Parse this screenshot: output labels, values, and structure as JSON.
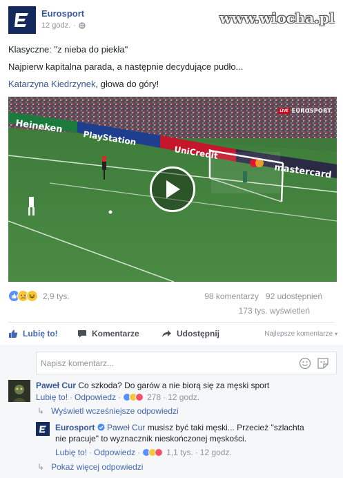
{
  "watermark": "www.wiocha.pl",
  "post": {
    "page_name": "Eurosport",
    "time": "12 godz.",
    "privacy_icon": "globe-icon",
    "lines": [
      "Klasyczne: \"z nieba do piekła\"",
      "Najpierw kapitalna parada, a następnie decydujące pudło..."
    ],
    "mention": "Katarzyna Kiedrzynek",
    "mention_suffix": ", głowa do góry!"
  },
  "video": {
    "live_tag": "LIVE",
    "channel_logo": "EUROSPORT",
    "ads": [
      "Heineken",
      "PlayStation",
      "UniCredit",
      "mastercard"
    ]
  },
  "stats": {
    "reactions_count": "2,9 tys.",
    "reaction_icons": [
      "like-icon",
      "sad-icon",
      "haha-icon"
    ],
    "comments": "98 komentarzy",
    "shares": "92 udostępnień",
    "views": "173 tys. wyświetleń"
  },
  "actions": {
    "like": "Lubię to!",
    "comment": "Komentarze",
    "share": "Udostępnij",
    "sort": "Najlepsze komentarze"
  },
  "comment_input": {
    "placeholder": "Napisz komentarz..."
  },
  "comments": [
    {
      "author": "Paweł Cur",
      "text": "Co szkoda? Do garów a nie biorą się za męski sport",
      "like": "Lubię to!",
      "reply": "Odpowiedz",
      "reactions": "278",
      "time": "12 godz."
    }
  ],
  "view_earlier_replies": "Wyświetl wcześniejsze odpowiedzi",
  "reply": {
    "author": "Eurosport",
    "mention": "Paweł Cur",
    "text_line1": "musisz być taki męski... Przecież \"szlachta",
    "text_line2": "nie pracuje\" to wyznacznik nieskończonej męskości.",
    "like": "Lubię to!",
    "reply": "Odpowiedz",
    "reactions": "1,1 tys.",
    "time": "12 godz."
  },
  "more_replies": "Pokaż więcej odpowiedzi",
  "colors": {
    "link": "#365899",
    "action_blue": "#4267b2",
    "meta_gray": "#90949c",
    "eurosport_navy": "#152a5c"
  }
}
